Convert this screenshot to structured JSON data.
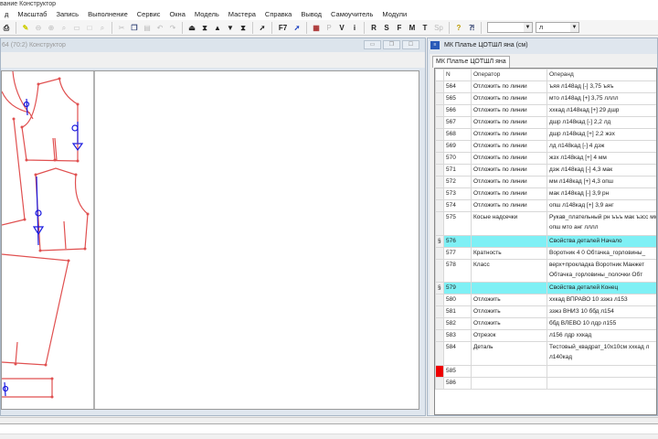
{
  "app_title": "вание Конструктор",
  "menu": [
    "д",
    "Масштаб",
    "Запись",
    "Выполнение",
    "Сервис",
    "Окна",
    "Модель",
    "Мастера",
    "Справка",
    "Вывод",
    "Самоучитель",
    "Модули"
  ],
  "toolbar": {
    "letters": [
      "F7",
      "P",
      "V",
      "i",
      "R",
      "S",
      "F",
      "M",
      "T",
      "Sp"
    ],
    "combo1": "",
    "combo2": "л"
  },
  "left_window": {
    "title": "64 (70:2) Конструктор"
  },
  "right_window": {
    "title": "МК Платье ЦОТШЛ яна (см)",
    "tab": "МК Платье ЦОТШЛ яна",
    "columns": [
      "N",
      "Оператор",
      "Операнд"
    ],
    "rows": [
      {
        "n": "564",
        "op": "Отложить по линии",
        "arg": "ъяя л148ад [-] 3,75 ъяъ"
      },
      {
        "n": "565",
        "op": "Отложить по линии",
        "arg": "мто л148ад [+] 3,75 лллл"
      },
      {
        "n": "566",
        "op": "Отложить по линии",
        "arg": "xxкад л148кад [+] 29 дшр"
      },
      {
        "n": "567",
        "op": "Отложить по линии",
        "arg": "дшр л148кад [-] 2,2 лд"
      },
      {
        "n": "568",
        "op": "Отложить по линии",
        "arg": "дшр л148кад [+] 2,2 жзх"
      },
      {
        "n": "569",
        "op": "Отложить по линии",
        "arg": "лд л148кад [-] 4 дзж"
      },
      {
        "n": "570",
        "op": "Отложить по линии",
        "arg": "жзх л148кад [+] 4 мм"
      },
      {
        "n": "571",
        "op": "Отложить по линии",
        "arg": "дзж л148кад [-] 4,3 мак"
      },
      {
        "n": "572",
        "op": "Отложить по линии",
        "arg": "мм л148кад [+] 4,3 опш"
      },
      {
        "n": "573",
        "op": "Отложить по линии",
        "arg": "мак л148кад [-] 3,9 рн"
      },
      {
        "n": "574",
        "op": "Отложить по линии",
        "arg": "опш л148кад [+] 3,9 анг"
      },
      {
        "n": "575",
        "op": "Косые надсечки",
        "arg": "Рукав_плательный рн ъъъ мак ъзсс мм ъзъ опш мто анг лллл",
        "dbl": true
      },
      {
        "n": "576",
        "op": "",
        "arg": "Свойства деталей Начало",
        "mark": "§",
        "cyan": true
      },
      {
        "n": "577",
        "op": "Кратность",
        "arg": "Воротник 4 0 Обтачка_горловины_"
      },
      {
        "n": "578",
        "op": "Класс",
        "arg": "верх+прокладка Воротник Манжет Обтачка_горловины_полочки Обт",
        "dbl": true
      },
      {
        "n": "579",
        "op": "",
        "arg": "Свойства деталей Конец",
        "mark": "§",
        "cyan": true
      },
      {
        "n": "580",
        "op": "Отложить",
        "arg": "xxкад ВПРАВО 10 ззжз л153"
      },
      {
        "n": "581",
        "op": "Отложить",
        "arg": "ззжз ВНИЗ 10 ббд л154"
      },
      {
        "n": "582",
        "op": "Отложить",
        "arg": "ббд ВЛЕВО 10 лдр л155"
      },
      {
        "n": "583",
        "op": "Отрезок",
        "arg": "л156 лдр xxкад"
      },
      {
        "n": "584",
        "op": "Деталь",
        "arg": "Тестовый_квадрат_10х10см xxкад л л140кад",
        "dbl": true
      },
      {
        "n": "585",
        "op": "",
        "arg": "",
        "red": true
      },
      {
        "n": "586",
        "op": "",
        "arg": ""
      }
    ]
  },
  "colors": {
    "pattern": "#e05050",
    "marks": "#1a1adf",
    "highlight": "#7ff0f5",
    "current": "#ee0000"
  }
}
